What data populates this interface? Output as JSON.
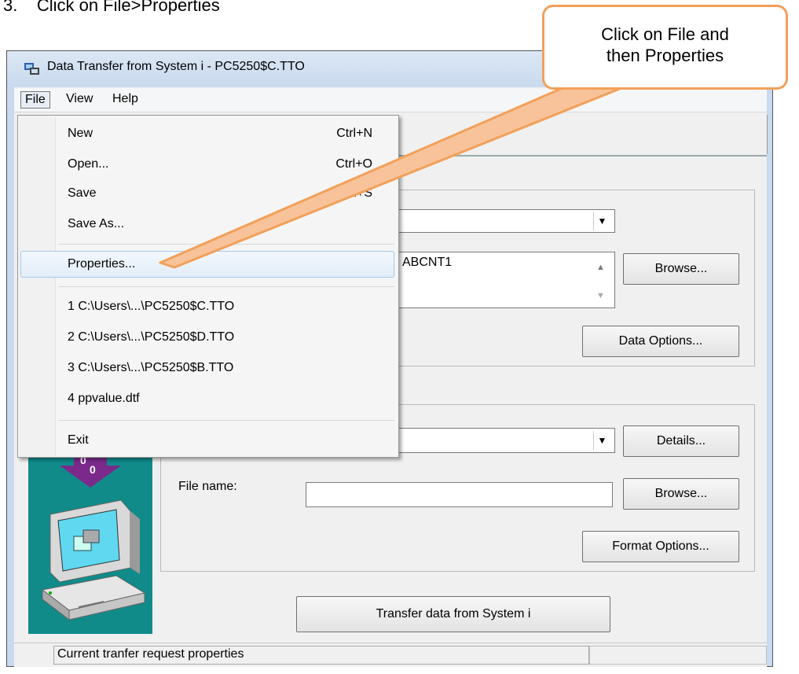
{
  "instruction": {
    "number": "3.",
    "text": "Click on File>Properties"
  },
  "window": {
    "title": "Data Transfer from System i - PC5250$C.TTO"
  },
  "menubar": {
    "items": [
      "File",
      "View",
      "Help"
    ]
  },
  "file_menu": {
    "items": [
      {
        "label": "New",
        "shortcut": "Ctrl+N"
      },
      {
        "label": "Open...",
        "shortcut": "Ctrl+O"
      },
      {
        "label": "Save",
        "shortcut": "Ctrl+S"
      },
      {
        "label": "Save As...",
        "shortcut": ""
      },
      {
        "label": "Properties...",
        "shortcut": ""
      },
      {
        "label": "1 C:\\Users\\...\\PC5250$C.TTO",
        "shortcut": ""
      },
      {
        "label": "2 C:\\Users\\...\\PC5250$D.TTO",
        "shortcut": ""
      },
      {
        "label": "3 C:\\Users\\...\\PC5250$B.TTO",
        "shortcut": ""
      },
      {
        "label": "4 ppvalue.dtf",
        "shortcut": ""
      },
      {
        "label": "Exit",
        "shortcut": ""
      }
    ],
    "highlighted": "Properties..."
  },
  "from_group": {
    "file_name_value": "ABCNT1",
    "browse_label": "Browse...",
    "data_options_label": "Data Options..."
  },
  "to_group": {
    "details_label": "Details...",
    "file_name_label": "File name:",
    "file_name_value": "",
    "browse_label": "Browse...",
    "format_options_label": "Format Options..."
  },
  "transfer_button": "Transfer data from System i",
  "status": "Current tranfer request properties",
  "callout": {
    "line1": "Click on File and",
    "line2": "then Properties",
    "border_color": "#f2a05a"
  },
  "icons": [
    "window-app-icon",
    "transfer-computer-icon",
    "dropdown-arrow-icon",
    "scroll-up-icon",
    "scroll-down-icon"
  ]
}
